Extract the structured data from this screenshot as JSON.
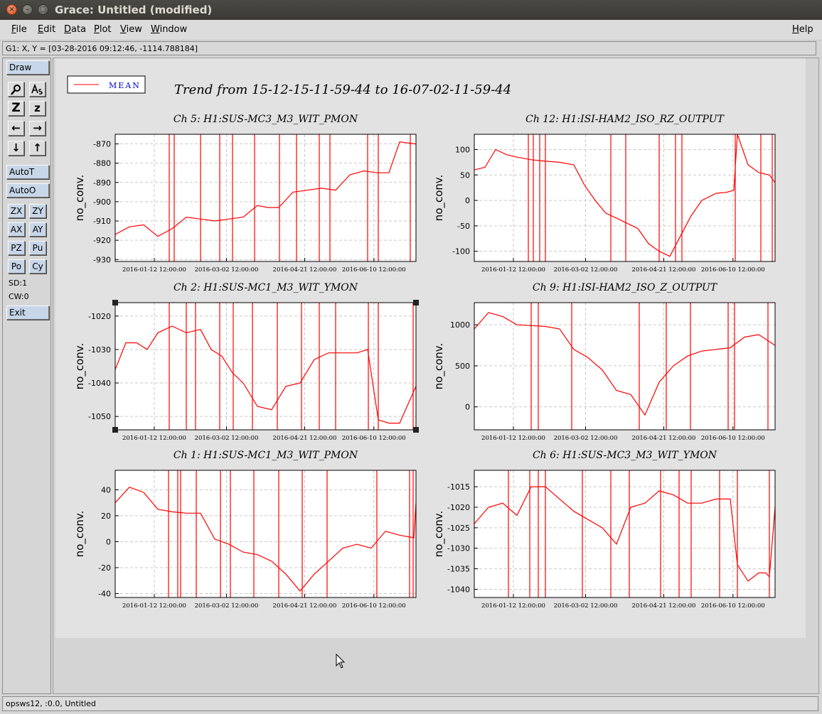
{
  "window": {
    "title": "Grace: Untitled (modified)",
    "menus": [
      {
        "pre": "",
        "u": "F",
        "post": "ile"
      },
      {
        "pre": "",
        "u": "E",
        "post": "dit"
      },
      {
        "pre": "",
        "u": "D",
        "post": "ata"
      },
      {
        "pre": "",
        "u": "P",
        "post": "lot"
      },
      {
        "pre": "",
        "u": "V",
        "post": "iew"
      },
      {
        "pre": "",
        "u": "W",
        "post": "indow"
      },
      {
        "pre": "",
        "u": "H",
        "post": "elp"
      }
    ],
    "locator": "G1: X, Y = [03-28-2016 09:12:46, -1114.788184]",
    "status": "opsws12, :0.0, Untitled"
  },
  "toolbox": {
    "draw": "Draw",
    "autot": "AutoT",
    "autoo": "AutoO",
    "exit": "Exit",
    "sd": "SD:1",
    "cw": "CW:0",
    "zoom_icons": [
      "zoom-icon",
      "text-icon",
      "zoom-z-icon",
      "zoom-z-small-icon"
    ],
    "arrow_icons": [
      "arrow-left-icon",
      "arrow-right-icon",
      "arrow-down-icon",
      "arrow-up-icon"
    ],
    "z_glyph": "Z",
    "z_small_glyph": "z",
    "small_buttons": [
      "ZX",
      "ZY",
      "AX",
      "AY",
      "PZ",
      "Pu",
      "Po",
      "Cy"
    ]
  },
  "figure": {
    "title": "Trend from 15-12-15-11-59-44 to 16-07-02-11-59-44",
    "legend": "MEAN",
    "line_color": "#ff0000",
    "x_ticks": [
      "2016-01-12 12:00:00",
      "2016-03-02 12:00:00",
      "2016-04-21 12:00:00",
      "2016-06-10 12:00:00"
    ]
  },
  "chart_data": [
    {
      "type": "line",
      "title": "Ch 5: H1:SUS-MC3_M3_WIT_PMON",
      "ylabel": "no_conv.",
      "x": [
        0,
        20,
        40,
        60,
        80,
        100,
        120,
        140,
        160,
        180,
        200,
        215,
        230,
        250,
        270,
        290,
        310,
        330,
        350,
        368,
        385,
        400,
        423
      ],
      "series": [
        {
          "name": "MEAN",
          "values": [
            -917,
            -913,
            -912,
            -918,
            -914,
            -908,
            -909,
            -910,
            -909,
            -908,
            -902,
            -903,
            -903,
            -895,
            -894,
            -893,
            -894,
            -886,
            -884,
            -885,
            -885,
            -869,
            -870
          ]
        }
      ],
      "spikes": [
        76,
        83,
        120,
        147,
        165,
        196,
        231,
        255,
        287,
        302,
        355,
        370,
        415
      ],
      "ylim": [
        -931,
        -865
      ],
      "yticks": [
        -870,
        -880,
        -890,
        -900,
        -910,
        -920,
        -930
      ],
      "grid": true
    },
    {
      "type": "line",
      "title": "Ch 12: H1:ISI-HAM2_ISO_RZ_OUTPUT",
      "ylabel": "no_conv.",
      "x": [
        0,
        15,
        30,
        45,
        60,
        80,
        100,
        120,
        140,
        155,
        170,
        185,
        200,
        215,
        230,
        245,
        260,
        275,
        290,
        305,
        320,
        340,
        355,
        365,
        370,
        385,
        400,
        415,
        423
      ],
      "series": [
        {
          "name": "MEAN",
          "values": [
            60,
            65,
            100,
            90,
            85,
            80,
            77,
            75,
            70,
            30,
            0,
            -25,
            -35,
            -45,
            -55,
            -85,
            -100,
            -110,
            -70,
            -30,
            0,
            14,
            16,
            20,
            130,
            70,
            55,
            50,
            35
          ]
        }
      ],
      "spikes": [
        76,
        83,
        92,
        100,
        192,
        213,
        260,
        283,
        292,
        367,
        403,
        419
      ],
      "ylim": [
        -120,
        130
      ],
      "yticks": [
        100,
        50,
        0,
        -50,
        -100
      ],
      "grid": true
    },
    {
      "type": "line",
      "title": "Ch 2: H1:SUS-MC1_M3_WIT_YMON",
      "ylabel": "no_conv.",
      "x": [
        0,
        15,
        30,
        45,
        60,
        80,
        100,
        120,
        135,
        150,
        165,
        180,
        200,
        220,
        240,
        260,
        280,
        300,
        320,
        340,
        355,
        370,
        385,
        400,
        423
      ],
      "series": [
        {
          "name": "MEAN",
          "values": [
            -1036,
            -1028,
            -1028,
            -1030,
            -1025,
            -1023,
            -1025,
            -1024,
            -1030,
            -1032,
            -1037,
            -1040,
            -1047,
            -1048,
            -1041,
            -1040,
            -1033,
            -1031,
            -1031,
            -1031,
            -1030,
            -1051,
            -1052,
            -1052,
            -1041
          ]
        }
      ],
      "spikes": [
        76,
        100,
        113,
        147,
        166,
        193,
        228,
        262,
        287,
        310,
        356,
        370,
        419
      ],
      "ylim": [
        -1054,
        -1016
      ],
      "yticks": [
        -1020,
        -1030,
        -1040,
        -1050
      ],
      "grid": true
    },
    {
      "type": "line",
      "title": "Ch 9: H1:ISI-HAM2_ISO_Z_OUTPUT",
      "ylabel": "no_conv.",
      "x": [
        0,
        20,
        40,
        60,
        80,
        100,
        120,
        140,
        160,
        180,
        200,
        220,
        240,
        260,
        280,
        300,
        320,
        340,
        360,
        380,
        400,
        423
      ],
      "series": [
        {
          "name": "MEAN",
          "values": [
            950,
            1150,
            1100,
            1000,
            990,
            980,
            950,
            700,
            600,
            450,
            200,
            150,
            -100,
            300,
            500,
            620,
            680,
            700,
            720,
            850,
            880,
            750
          ]
        }
      ],
      "spikes": [
        80,
        90,
        137,
        232,
        270,
        304,
        357,
        366,
        413
      ],
      "ylim": [
        -280,
        1270
      ],
      "yticks": [
        1000,
        500,
        0
      ],
      "grid": true
    },
    {
      "type": "line",
      "title": "Ch 1: H1:SUS-MC1_M3_WIT_PMON",
      "ylabel": "no_conv.",
      "x": [
        0,
        20,
        40,
        60,
        80,
        100,
        120,
        140,
        160,
        180,
        200,
        220,
        240,
        260,
        280,
        300,
        320,
        340,
        360,
        380,
        400,
        420,
        423
      ],
      "series": [
        {
          "name": "MEAN",
          "values": [
            30,
            42,
            38,
            25,
            23,
            22,
            22,
            2,
            -2,
            -8,
            -10,
            -15,
            -25,
            -38,
            -25,
            -15,
            -5,
            -2,
            -5,
            8,
            5,
            3,
            30
          ]
        }
      ],
      "spikes": [
        75,
        88,
        92,
        114,
        148,
        162,
        195,
        230,
        263,
        298,
        368,
        414,
        419
      ],
      "ylim": [
        -43,
        55
      ],
      "yticks": [
        40,
        20,
        0,
        -20,
        -40
      ],
      "grid": true
    },
    {
      "type": "line",
      "title": "Ch 6: H1:SUS-MC3_M3_WIT_YMON",
      "ylabel": "no_conv.",
      "x": [
        0,
        20,
        40,
        60,
        80,
        100,
        120,
        140,
        160,
        180,
        200,
        220,
        240,
        260,
        280,
        300,
        320,
        340,
        360,
        370,
        385,
        400,
        410,
        415,
        423
      ],
      "series": [
        {
          "name": "MEAN",
          "values": [
            -1024,
            -1020,
            -1019,
            -1022,
            -1015,
            -1015,
            -1018,
            -1021,
            -1023,
            -1025,
            -1029,
            -1020,
            -1019,
            -1016,
            -1017,
            -1019,
            -1019,
            -1018,
            -1018,
            -1034,
            -1038,
            -1036,
            -1036,
            -1037,
            -1020
          ]
        }
      ],
      "spikes": [
        48,
        78,
        90,
        100,
        152,
        192,
        218,
        262,
        288,
        305,
        345,
        370,
        415
      ],
      "ylim": [
        -1042,
        -1011
      ],
      "yticks": [
        -1015,
        -1020,
        -1025,
        -1030,
        -1035,
        -1040
      ],
      "grid": true
    }
  ]
}
